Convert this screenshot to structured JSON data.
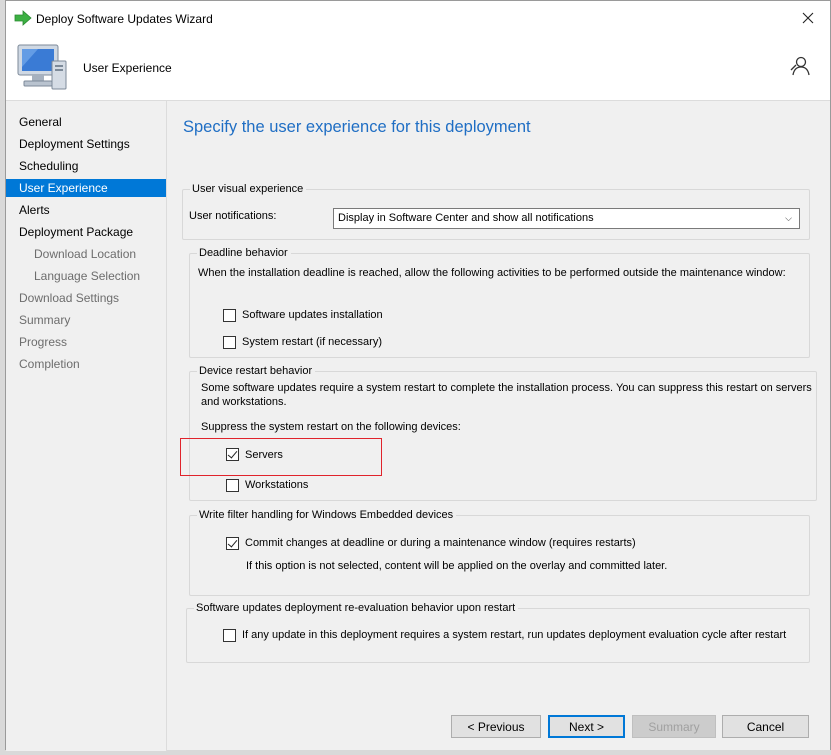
{
  "window": {
    "title": "Deploy Software Updates Wizard"
  },
  "header": {
    "page_title": "User Experience"
  },
  "sidebar": {
    "items": [
      {
        "label": "General"
      },
      {
        "label": "Deployment Settings"
      },
      {
        "label": "Scheduling"
      },
      {
        "label": "User Experience"
      },
      {
        "label": "Alerts"
      },
      {
        "label": "Deployment Package"
      },
      {
        "label": "Download Location"
      },
      {
        "label": "Language Selection"
      },
      {
        "label": "Download Settings"
      },
      {
        "label": "Summary"
      },
      {
        "label": "Progress"
      },
      {
        "label": "Completion"
      }
    ]
  },
  "main": {
    "heading": "Specify the user experience for this deployment",
    "user_visual": {
      "legend": "User visual experience",
      "notifications_label": "User notifications:",
      "notifications_value": "Display in Software Center and show all notifications"
    },
    "deadline": {
      "legend": "Deadline behavior",
      "description": "When the installation deadline is reached, allow the following activities to be performed outside the maintenance window:",
      "software_updates_installation": {
        "label": "Software updates installation",
        "checked": false
      },
      "system_restart": {
        "label": "System restart (if necessary)",
        "checked": false
      }
    },
    "device_restart": {
      "legend": "Device restart behavior",
      "description_line1": "Some software updates require a system restart to complete the installation process. You can suppress this restart on servers",
      "description_line2": "and workstations.",
      "suppress_label": "Suppress the system restart on the following devices:",
      "servers": {
        "label": "Servers",
        "checked": true
      },
      "workstations": {
        "label": "Workstations",
        "checked": false
      }
    },
    "write_filter": {
      "legend": "Write filter handling for Windows Embedded devices",
      "commit": {
        "label": "Commit changes at deadline or during a maintenance window (requires restarts)",
        "checked": true
      },
      "note": "If this option is not selected, content will be applied on the overlay and committed later."
    },
    "reevaluation": {
      "legend": "Software updates deployment re-evaluation behavior upon restart",
      "option": {
        "label": "If any update in this deployment requires a system restart, run updates deployment evaluation cycle after restart",
        "checked": false
      }
    }
  },
  "footer": {
    "previous": "< Previous",
    "next": "Next >",
    "summary": "Summary",
    "cancel": "Cancel"
  },
  "colors": {
    "accent": "#0078d7",
    "heading": "#1f6ec4",
    "highlight": "#e0232b"
  }
}
